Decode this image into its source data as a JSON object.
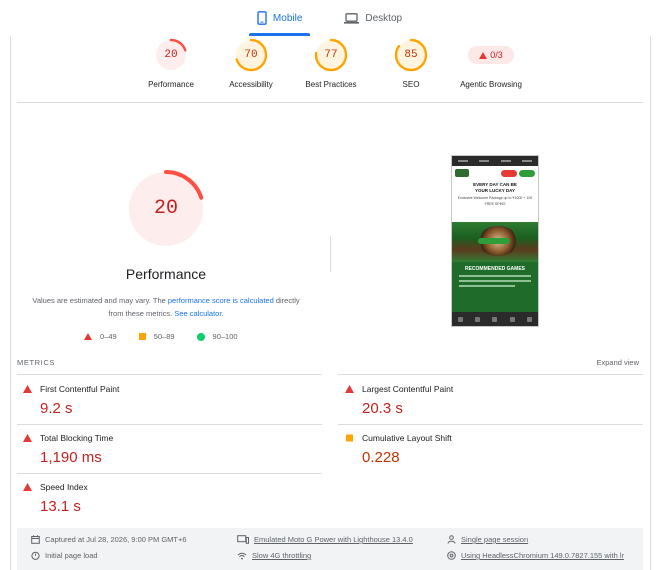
{
  "tabs": [
    {
      "label": "Mobile",
      "active": true
    },
    {
      "label": "Desktop",
      "active": false
    }
  ],
  "categories": [
    {
      "label": "Performance",
      "score": "20",
      "rating": "fail"
    },
    {
      "label": "Accessibility",
      "score": "70",
      "rating": "average"
    },
    {
      "label": "Best Practices",
      "score": "77",
      "rating": "average"
    },
    {
      "label": "SEO",
      "score": "85",
      "rating": "average"
    },
    {
      "label": "Agentic Browsing",
      "score": "0/3",
      "rating": "fail"
    }
  ],
  "performance": {
    "score": "20",
    "title": "Performance",
    "note_pre": "Values are estimated and may vary. The ",
    "note_link1": "performance score is calculated",
    "note_mid": " directly from these metrics. ",
    "note_link2": "See calculator.",
    "legend": [
      "0–49",
      "50–89",
      "90–100"
    ]
  },
  "screenshot": {
    "hero_line1": "EVERY DAY CAN BE",
    "hero_line2": "YOUR LUCKY DAY",
    "hero_sub": "Exclusive Welcome Package up to ₹1000 + 100 FREE SPINS",
    "cta": "REGISTER NOW",
    "section_title": "RECOMMENDED GAMES"
  },
  "metrics": {
    "header": "METRICS",
    "expand_label": "Expand view",
    "items": [
      {
        "name": "First Contentful Paint",
        "value": "9.2 s",
        "rating": "fail"
      },
      {
        "name": "Largest Contentful Paint",
        "value": "20.3 s",
        "rating": "fail"
      },
      {
        "name": "Total Blocking Time",
        "value": "1,190 ms",
        "rating": "fail"
      },
      {
        "name": "Cumulative Layout Shift",
        "value": "0.228",
        "rating": "average"
      },
      {
        "name": "Speed Index",
        "value": "13.1 s",
        "rating": "fail"
      }
    ]
  },
  "footer": {
    "captured": "Captured at Jul 28, 2026, 9:00 PM GMT+6",
    "device": "Emulated Moto G Power with Lighthouse 13.4.0",
    "session": "Single page session",
    "load": "Initial page load",
    "throttling": "Slow 4G throttling",
    "browser": "Using HeadlessChromium 149.0.7827.155 with lr"
  },
  "colors": {
    "fail": "#c5221f",
    "fail_ring": "#ff4e42",
    "average": "#c33300",
    "average_ring": "#ffa400",
    "pass": "#0cce6b",
    "accent": "#1a73e8"
  }
}
